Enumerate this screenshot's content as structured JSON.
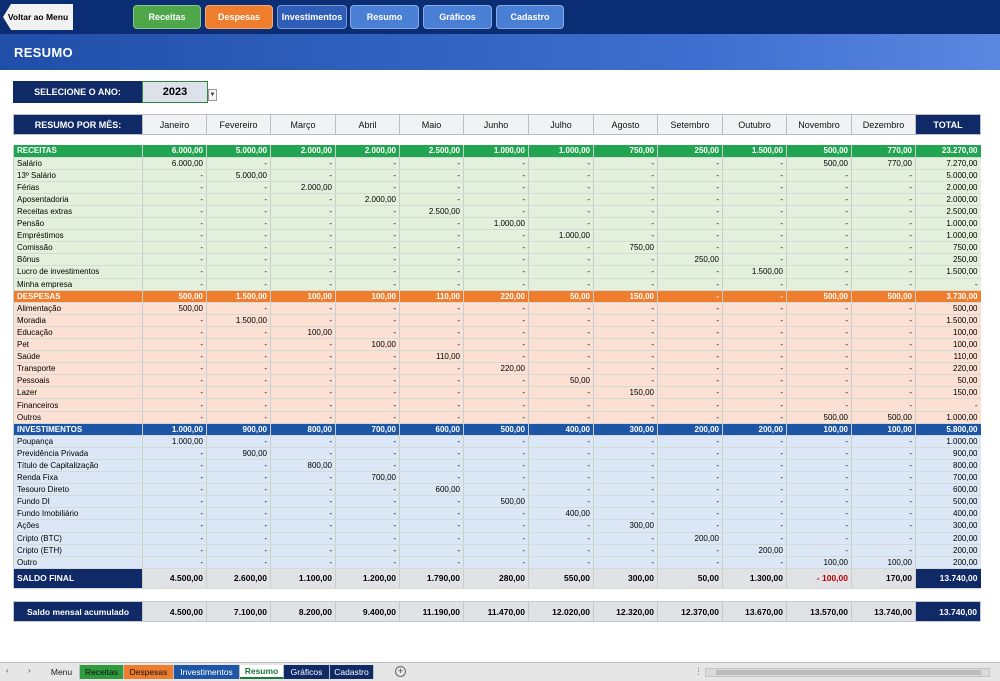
{
  "toolbar": {
    "back_label": "Voltar ao Menu",
    "buttons": [
      {
        "label": "Receitas",
        "color": "#4ea84a"
      },
      {
        "label": "Despesas",
        "color": "#ef7d2e"
      },
      {
        "label": "Investimentos",
        "color": "#2f5eb8"
      },
      {
        "label": "Resumo",
        "color": "#4a7fd6"
      },
      {
        "label": "Gráficos",
        "color": "#4a7fd6"
      },
      {
        "label": "Cadastro",
        "color": "#4a7fd6"
      }
    ]
  },
  "page_title": "RESUMO",
  "year_selector": {
    "label": "SELECIONE O ANO:",
    "value": "2023"
  },
  "summary_header": {
    "label": "RESUMO POR MÊS:",
    "months": [
      "Janeiro",
      "Fevereiro",
      "Março",
      "Abril",
      "Maio",
      "Junho",
      "Julho",
      "Agosto",
      "Setembro",
      "Outubro",
      "Novembro",
      "Dezembro"
    ],
    "total_label": "TOTAL"
  },
  "sections": [
    {
      "type": "receitas",
      "header": {
        "label": "RECEITAS",
        "values": [
          "6.000,00",
          "5.000,00",
          "2.000,00",
          "2.000,00",
          "2.500,00",
          "1.000,00",
          "1.000,00",
          "750,00",
          "250,00",
          "1.500,00",
          "500,00",
          "770,00"
        ],
        "total": "23.270,00"
      },
      "rows": [
        {
          "label": "Salário",
          "values": [
            "6.000,00",
            "-",
            "-",
            "-",
            "-",
            "-",
            "-",
            "-",
            "-",
            "-",
            "500,00",
            "770,00"
          ],
          "total": "7.270,00"
        },
        {
          "label": "13º Salário",
          "values": [
            "-",
            "5.000,00",
            "-",
            "-",
            "-",
            "-",
            "-",
            "-",
            "-",
            "-",
            "-",
            "-"
          ],
          "total": "5.000,00"
        },
        {
          "label": "Férias",
          "values": [
            "-",
            "-",
            "2.000,00",
            "-",
            "-",
            "-",
            "-",
            "-",
            "-",
            "-",
            "-",
            "-"
          ],
          "total": "2.000,00"
        },
        {
          "label": "Aposentadoria",
          "values": [
            "-",
            "-",
            "-",
            "2.000,00",
            "-",
            "-",
            "-",
            "-",
            "-",
            "-",
            "-",
            "-"
          ],
          "total": "2.000,00"
        },
        {
          "label": "Receitas extras",
          "values": [
            "-",
            "-",
            "-",
            "-",
            "2.500,00",
            "-",
            "-",
            "-",
            "-",
            "-",
            "-",
            "-"
          ],
          "total": "2.500,00"
        },
        {
          "label": "Pensão",
          "values": [
            "-",
            "-",
            "-",
            "-",
            "-",
            "1.000,00",
            "-",
            "-",
            "-",
            "-",
            "-",
            "-"
          ],
          "total": "1.000,00"
        },
        {
          "label": "Empréstimos",
          "values": [
            "-",
            "-",
            "-",
            "-",
            "-",
            "-",
            "1.000,00",
            "-",
            "-",
            "-",
            "-",
            "-"
          ],
          "total": "1.000,00"
        },
        {
          "label": "Comissão",
          "values": [
            "-",
            "-",
            "-",
            "-",
            "-",
            "-",
            "-",
            "750,00",
            "-",
            "-",
            "-",
            "-"
          ],
          "total": "750,00"
        },
        {
          "label": "Bônus",
          "values": [
            "-",
            "-",
            "-",
            "-",
            "-",
            "-",
            "-",
            "-",
            "250,00",
            "-",
            "-",
            "-"
          ],
          "total": "250,00"
        },
        {
          "label": "Lucro de investimentos",
          "values": [
            "-",
            "-",
            "-",
            "-",
            "-",
            "-",
            "-",
            "-",
            "-",
            "1.500,00",
            "-",
            "-"
          ],
          "total": "1.500,00"
        },
        {
          "label": "Minha empresa",
          "values": [
            "-",
            "-",
            "-",
            "-",
            "-",
            "-",
            "-",
            "-",
            "-",
            "-",
            "-",
            "-"
          ],
          "total": "-"
        }
      ]
    },
    {
      "type": "despesas",
      "header": {
        "label": "DESPESAS",
        "values": [
          "500,00",
          "1.500,00",
          "100,00",
          "100,00",
          "110,00",
          "220,00",
          "50,00",
          "150,00",
          "-",
          "-",
          "500,00",
          "500,00"
        ],
        "total": "3.730,00"
      },
      "rows": [
        {
          "label": "Alimentação",
          "values": [
            "500,00",
            "-",
            "-",
            "-",
            "-",
            "-",
            "-",
            "-",
            "-",
            "-",
            "-",
            "-"
          ],
          "total": "500,00"
        },
        {
          "label": "Moradia",
          "values": [
            "-",
            "1.500,00",
            "-",
            "-",
            "-",
            "-",
            "-",
            "-",
            "-",
            "-",
            "-",
            "-"
          ],
          "total": "1.500,00"
        },
        {
          "label": "Educação",
          "values": [
            "-",
            "-",
            "100,00",
            "-",
            "-",
            "-",
            "-",
            "-",
            "-",
            "-",
            "-",
            "-"
          ],
          "total": "100,00"
        },
        {
          "label": "Pet",
          "values": [
            "-",
            "-",
            "-",
            "100,00",
            "-",
            "-",
            "-",
            "-",
            "-",
            "-",
            "-",
            "-"
          ],
          "total": "100,00"
        },
        {
          "label": "Saúde",
          "values": [
            "-",
            "-",
            "-",
            "-",
            "110,00",
            "-",
            "-",
            "-",
            "-",
            "-",
            "-",
            "-"
          ],
          "total": "110,00"
        },
        {
          "label": "Transporte",
          "values": [
            "-",
            "-",
            "-",
            "-",
            "-",
            "220,00",
            "-",
            "-",
            "-",
            "-",
            "-",
            "-"
          ],
          "total": "220,00"
        },
        {
          "label": "Pessoais",
          "values": [
            "-",
            "-",
            "-",
            "-",
            "-",
            "-",
            "50,00",
            "-",
            "-",
            "-",
            "-",
            "-"
          ],
          "total": "50,00"
        },
        {
          "label": "Lazer",
          "values": [
            "-",
            "-",
            "-",
            "-",
            "-",
            "-",
            "-",
            "150,00",
            "-",
            "-",
            "-",
            "-"
          ],
          "total": "150,00"
        },
        {
          "label": "Financeiros",
          "values": [
            "-",
            "-",
            "-",
            "-",
            "-",
            "-",
            "-",
            "-",
            "-",
            "-",
            "-",
            "-"
          ],
          "total": "-"
        },
        {
          "label": "Outros",
          "values": [
            "-",
            "-",
            "-",
            "-",
            "-",
            "-",
            "-",
            "-",
            "-",
            "-",
            "500,00",
            "500,00"
          ],
          "total": "1.000,00"
        }
      ]
    },
    {
      "type": "investimentos",
      "header": {
        "label": "INVESTIMENTOS",
        "values": [
          "1.000,00",
          "900,00",
          "800,00",
          "700,00",
          "600,00",
          "500,00",
          "400,00",
          "300,00",
          "200,00",
          "200,00",
          "100,00",
          "100,00"
        ],
        "total": "5.800,00"
      },
      "rows": [
        {
          "label": "Poupança",
          "values": [
            "1.000,00",
            "-",
            "-",
            "-",
            "-",
            "-",
            "-",
            "-",
            "-",
            "-",
            "-",
            "-"
          ],
          "total": "1.000,00"
        },
        {
          "label": "Previdência Privada",
          "values": [
            "-",
            "900,00",
            "-",
            "-",
            "-",
            "-",
            "-",
            "-",
            "-",
            "-",
            "-",
            "-"
          ],
          "total": "900,00"
        },
        {
          "label": "Título de Capitalização",
          "values": [
            "-",
            "-",
            "800,00",
            "-",
            "-",
            "-",
            "-",
            "-",
            "-",
            "-",
            "-",
            "-"
          ],
          "total": "800,00"
        },
        {
          "label": "Renda Fixa",
          "values": [
            "-",
            "-",
            "-",
            "700,00",
            "-",
            "-",
            "-",
            "-",
            "-",
            "-",
            "-",
            "-"
          ],
          "total": "700,00"
        },
        {
          "label": "Tesouro Direto",
          "values": [
            "-",
            "-",
            "-",
            "-",
            "600,00",
            "-",
            "-",
            "-",
            "-",
            "-",
            "-",
            "-"
          ],
          "total": "600,00"
        },
        {
          "label": "Fundo DI",
          "values": [
            "-",
            "-",
            "-",
            "-",
            "-",
            "500,00",
            "-",
            "-",
            "-",
            "-",
            "-",
            "-"
          ],
          "total": "500,00"
        },
        {
          "label": "Fundo Imobiliário",
          "values": [
            "-",
            "-",
            "-",
            "-",
            "-",
            "-",
            "400,00",
            "-",
            "-",
            "-",
            "-",
            "-"
          ],
          "total": "400,00"
        },
        {
          "label": "Ações",
          "values": [
            "-",
            "-",
            "-",
            "-",
            "-",
            "-",
            "-",
            "300,00",
            "-",
            "-",
            "-",
            "-"
          ],
          "total": "300,00"
        },
        {
          "label": "Cripto (BTC)",
          "values": [
            "-",
            "-",
            "-",
            "-",
            "-",
            "-",
            "-",
            "-",
            "200,00",
            "-",
            "-",
            "-"
          ],
          "total": "200,00"
        },
        {
          "label": "Cripto (ETH)",
          "values": [
            "-",
            "-",
            "-",
            "-",
            "-",
            "-",
            "-",
            "-",
            "-",
            "200,00",
            "-",
            "-"
          ],
          "total": "200,00"
        },
        {
          "label": "Outro",
          "values": [
            "-",
            "-",
            "-",
            "-",
            "-",
            "-",
            "-",
            "-",
            "-",
            "-",
            "100,00",
            "100,00"
          ],
          "total": "200,00"
        }
      ]
    }
  ],
  "saldo_final": {
    "label": "SALDO FINAL",
    "values": [
      "4.500,00",
      "2.600,00",
      "1.100,00",
      "1.200,00",
      "1.790,00",
      "280,00",
      "550,00",
      "300,00",
      "50,00",
      "1.300,00",
      "-   100,00",
      "170,00"
    ],
    "negative_index": 10,
    "total": "13.740,00"
  },
  "saldo_acumulado": {
    "label": "Saldo mensal acumulado",
    "values": [
      "4.500,00",
      "7.100,00",
      "8.200,00",
      "9.400,00",
      "11.190,00",
      "11.470,00",
      "12.020,00",
      "12.320,00",
      "12.370,00",
      "13.670,00",
      "13.570,00",
      "13.740,00"
    ],
    "total": "13.740,00"
  },
  "sheet_tabs": {
    "tabs": [
      {
        "label": "Menu",
        "bg": "#e6e6e6",
        "color": "#222"
      },
      {
        "label": "Receitas",
        "bg": "#2e9b3d",
        "color": "#111"
      },
      {
        "label": "Despesas",
        "bg": "#ef7d2e",
        "color": "#111"
      },
      {
        "label": "Investimentos",
        "bg": "#1d56a6",
        "color": "#ffffff"
      },
      {
        "label": "Resumo",
        "bg": "#ffffff",
        "color": "#1a7a3c",
        "active": true
      },
      {
        "label": "Gráficos",
        "bg": "#0f2a67",
        "color": "#ffffff"
      },
      {
        "label": "Cadastro",
        "bg": "#0f2a67",
        "color": "#ffffff"
      }
    ],
    "add_icon": "plus-circle-icon",
    "nav_icons": [
      "chevron-left-icon",
      "chevron-right-icon"
    ]
  }
}
